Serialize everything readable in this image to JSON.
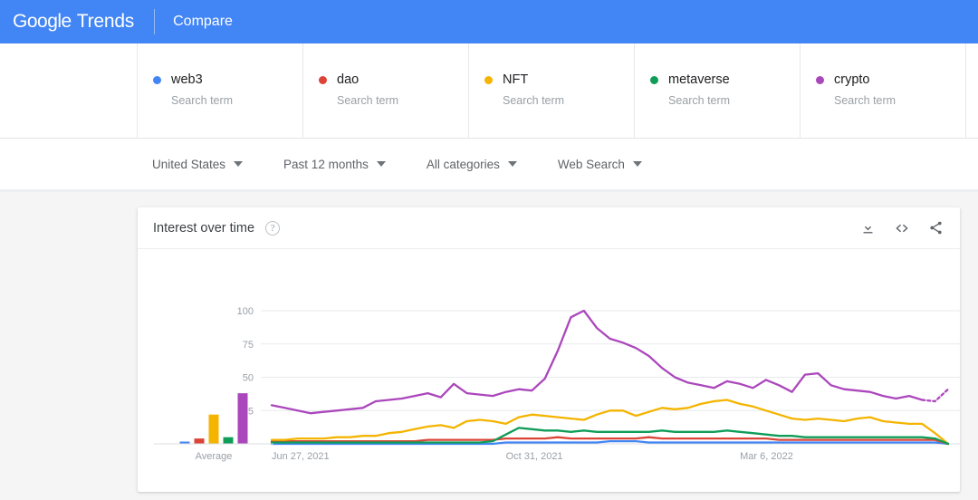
{
  "topbar": {
    "brand_google": "Google",
    "brand_trends": "Trends",
    "compare": "Compare"
  },
  "terms": [
    {
      "name": "web3",
      "subtitle": "Search term",
      "color": "#4285f4"
    },
    {
      "name": "dao",
      "subtitle": "Search term",
      "color": "#db4437"
    },
    {
      "name": "NFT",
      "subtitle": "Search term",
      "color": "#f4b400"
    },
    {
      "name": "metaverse",
      "subtitle": "Search term",
      "color": "#0f9d58"
    },
    {
      "name": "crypto",
      "subtitle": "Search term",
      "color": "#ab47bc"
    }
  ],
  "filters": [
    {
      "label": "United States",
      "name": "region-filter"
    },
    {
      "label": "Past 12 months",
      "name": "time-filter"
    },
    {
      "label": "All categories",
      "name": "category-filter"
    },
    {
      "label": "Web Search",
      "name": "search-type-filter"
    }
  ],
  "card": {
    "title": "Interest over time",
    "help": "?",
    "actions": [
      {
        "icon": "download-icon"
      },
      {
        "icon": "embed-code-icon"
      },
      {
        "icon": "share-icon"
      }
    ]
  },
  "chart_data": {
    "type": "line",
    "title": "Interest over time",
    "xlabel": "",
    "ylabel": "",
    "ylim": [
      0,
      100
    ],
    "yticks": [
      25,
      50,
      75,
      100
    ],
    "grid": true,
    "legend": "top-cards",
    "xtick_labels": [
      "Jun 27, 2021",
      "Oct 31, 2021",
      "Mar 6, 2022"
    ],
    "xtick_positions": [
      0,
      18,
      36
    ],
    "n_points": 53,
    "partial_last_points": 2,
    "average_label": "Average",
    "averages": [
      {
        "name": "web3",
        "value": 1,
        "color": "#4285f4"
      },
      {
        "name": "dao",
        "value": 4,
        "color": "#db4437"
      },
      {
        "name": "NFT",
        "value": 22,
        "color": "#f4b400"
      },
      {
        "name": "metaverse",
        "value": 5,
        "color": "#0f9d58"
      },
      {
        "name": "crypto",
        "value": 38,
        "color": "#ab47bc"
      }
    ],
    "series": [
      {
        "name": "web3",
        "color": "#4285f4",
        "values": [
          0,
          0,
          0,
          0,
          0,
          0,
          0,
          0,
          0,
          0,
          0,
          0,
          0,
          0,
          0,
          0,
          0,
          0,
          1,
          1,
          1,
          1,
          1,
          1,
          1,
          1,
          2,
          2,
          2,
          1,
          1,
          1,
          1,
          1,
          1,
          1,
          1,
          1,
          1,
          1,
          1,
          1,
          1,
          1,
          1,
          1,
          1,
          1,
          1,
          1,
          1,
          1,
          0
        ]
      },
      {
        "name": "dao",
        "color": "#db4437",
        "values": [
          2,
          2,
          2,
          2,
          2,
          2,
          2,
          2,
          2,
          2,
          2,
          2,
          3,
          3,
          3,
          3,
          3,
          3,
          4,
          4,
          4,
          4,
          5,
          4,
          4,
          4,
          4,
          4,
          4,
          5,
          4,
          4,
          4,
          4,
          4,
          4,
          4,
          4,
          4,
          3,
          3,
          3,
          3,
          3,
          3,
          3,
          3,
          3,
          3,
          3,
          3,
          3,
          0
        ]
      },
      {
        "name": "NFT",
        "color": "#f4b400",
        "values": [
          3,
          3,
          4,
          4,
          4,
          5,
          5,
          6,
          6,
          8,
          9,
          11,
          13,
          14,
          12,
          17,
          18,
          17,
          15,
          20,
          22,
          21,
          20,
          19,
          18,
          22,
          25,
          25,
          21,
          24,
          27,
          26,
          27,
          30,
          32,
          33,
          30,
          28,
          25,
          22,
          19,
          18,
          19,
          18,
          17,
          19,
          20,
          17,
          16,
          15,
          15,
          8,
          0
        ]
      },
      {
        "name": "metaverse",
        "color": "#0f9d58",
        "values": [
          1,
          1,
          1,
          1,
          1,
          1,
          1,
          1,
          1,
          1,
          1,
          1,
          1,
          1,
          1,
          1,
          1,
          2,
          7,
          12,
          11,
          10,
          10,
          9,
          10,
          9,
          9,
          9,
          9,
          9,
          10,
          9,
          9,
          9,
          9,
          10,
          9,
          8,
          7,
          6,
          6,
          5,
          5,
          5,
          5,
          5,
          5,
          5,
          5,
          5,
          5,
          4,
          0
        ]
      },
      {
        "name": "crypto",
        "color": "#ab47bc",
        "values": [
          29,
          27,
          25,
          23,
          24,
          25,
          26,
          27,
          32,
          33,
          34,
          36,
          38,
          35,
          45,
          38,
          37,
          36,
          39,
          41,
          40,
          49,
          70,
          95,
          100,
          87,
          79,
          76,
          72,
          66,
          57,
          50,
          46,
          44,
          42,
          47,
          45,
          42,
          48,
          44,
          39,
          52,
          53,
          44,
          41,
          40,
          39,
          36,
          34,
          36,
          33,
          32,
          41
        ],
        "dashed_from_index": 50
      }
    ]
  }
}
